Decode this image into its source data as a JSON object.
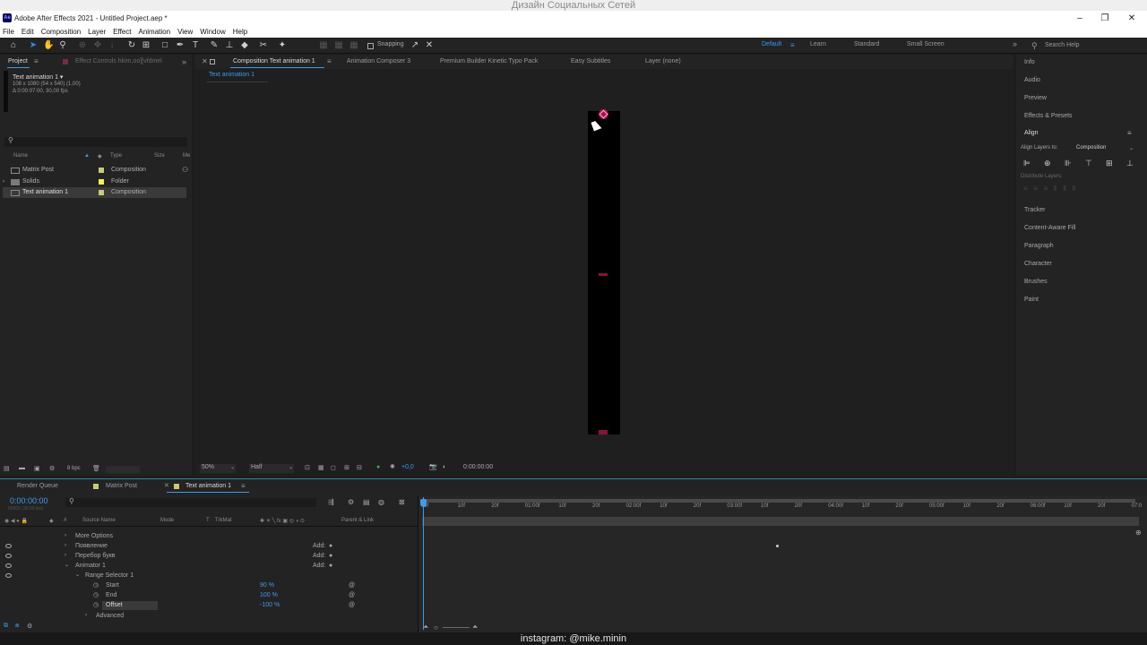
{
  "watermark_top": "Дизайн Социальных Сетей",
  "window": {
    "title": "Adobe After Effects 2021 - Untitled Project.aep *",
    "logo": "Ae",
    "controls": [
      "–",
      "❐",
      "✕"
    ]
  },
  "menu": [
    "File",
    "Edit",
    "Composition",
    "Layer",
    "Effect",
    "Animation",
    "View",
    "Window",
    "Help"
  ],
  "toolbar": {
    "snapping_label": "Snapping",
    "workspaces": [
      "Default",
      "Learn",
      "Standard",
      "Small Screen"
    ],
    "active_workspace": "Default",
    "search_help": "Search Help"
  },
  "project_panel": {
    "tabs": [
      "Project",
      "Effect Controls hkim,oo][vfdmel"
    ],
    "comp_name": "Text animation 1 ▾",
    "comp_info_1": "108 x 1080  (54 x 540) (1,00)",
    "comp_info_2": "Δ 0:00:07:00, 30,00 fps",
    "columns": [
      "Name",
      "Type",
      "Size",
      "Me"
    ],
    "items": [
      {
        "name": "Matrix Post",
        "type": "Composition",
        "color": "#c9c97a"
      },
      {
        "name": "Solids",
        "type": "Folder",
        "color": "#f3f34d"
      },
      {
        "name": "Text animation 1",
        "type": "Composition",
        "color": "#c9c97a"
      }
    ],
    "bpc": "8 bpc"
  },
  "comp_panel": {
    "tabs": [
      "Composition Text animation 1",
      "Animation Composer 3",
      "Premium Builder Kinetic Typo Pack",
      "Easy Subtitles",
      "Layer (none)"
    ],
    "breadcrumb": "Text animation 1",
    "zoom": "50%",
    "resolution": "Half",
    "exposure": "+0,0",
    "timecode": "0:00:00:00"
  },
  "right_panel": {
    "items": [
      "Info",
      "Audio",
      "Preview",
      "Effects & Presets"
    ],
    "align_title": "Align",
    "align_layers_to_label": "Align Layers to:",
    "align_layers_to_value": "Composition",
    "distribute_label": "Distribute Layers:",
    "items_bottom": [
      "Tracker",
      "Content-Aware Fill",
      "Paragraph",
      "Character",
      "Brushes",
      "Paint"
    ]
  },
  "timeline": {
    "tabs": [
      "Render Queue",
      "Matrix Post",
      "Text animation 1"
    ],
    "timecode": "0:00:00:00",
    "sub_timecode": "00000 (30.00 fps)",
    "columns": [
      "#",
      "Source Name",
      "Mode",
      "T",
      "TrkMat",
      "Parent & Link"
    ],
    "rows": [
      {
        "label": "More Options",
        "indent": 84,
        "add": ""
      },
      {
        "label": "Появление",
        "indent": 84,
        "add": "Add:"
      },
      {
        "label": "Перебор букв",
        "indent": 84,
        "add": "Add:"
      },
      {
        "label": "Animator 1",
        "indent": 84,
        "add": "Add:"
      },
      {
        "label": "Range Selector 1",
        "indent": 95,
        "add": ""
      },
      {
        "label": "Start",
        "indent": 118,
        "value": "90 %"
      },
      {
        "label": "End",
        "indent": 118,
        "value": "100 %"
      },
      {
        "label": "Offset",
        "indent": 118,
        "value": "-100 %"
      },
      {
        "label": "Advanced",
        "indent": 107,
        "add": ""
      }
    ],
    "ruler": [
      "0f",
      "10f",
      "20f",
      "01:00f",
      "10f",
      "20f",
      "02:00f",
      "10f",
      "20f",
      "03:00f",
      "10f",
      "20f",
      "04:00f",
      "10f",
      "20f",
      "05:00f",
      "10f",
      "20f",
      "06:00f",
      "10f",
      "20f",
      "07:0"
    ]
  },
  "watermark_bottom": "instagram: @mike.minin",
  "colors": {
    "accent": "#3d9be9",
    "panel": "#232323",
    "bg": "#1d1d1d"
  }
}
